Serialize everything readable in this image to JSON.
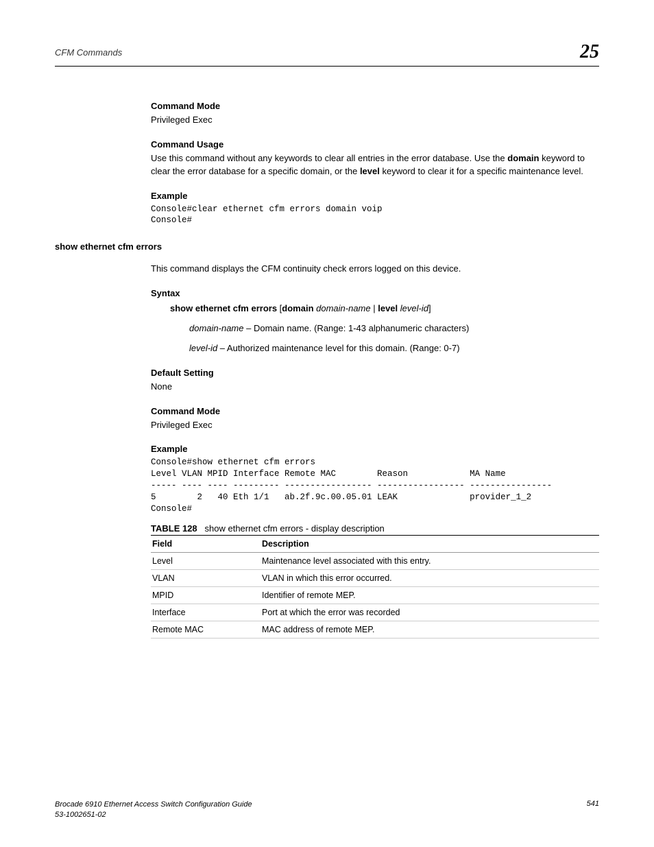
{
  "header": {
    "title": "CFM Commands",
    "chapter": "25"
  },
  "sections": {
    "commandMode1": {
      "heading": "Command Mode",
      "text": "Privileged Exec"
    },
    "commandUsage": {
      "heading": "Command Usage",
      "prefix": "Use this command without any keywords to clear all entries in the error database. Use the ",
      "kw1": "domain",
      "mid": " keyword to clear the error database for a specific domain, or the ",
      "kw2": "level",
      "suffix": " keyword to clear it for a specific maintenance level."
    },
    "example1": {
      "heading": "Example",
      "code": "Console#clear ethernet cfm errors domain voip\nConsole#"
    },
    "commandTitle": "show ethernet cfm errors",
    "intro": "This command displays the CFM continuity check errors logged on this device.",
    "syntax": {
      "heading": "Syntax",
      "cmd": "show ethernet cfm errors",
      "bracket_open": " [",
      "kw_domain": "domain",
      "domain_name": " domain-name",
      "pipe": " | ",
      "kw_level": "level",
      "level_id": " level-id",
      "bracket_close": "]",
      "domain_name_lbl": "domain-name",
      "domain_name_desc": " – Domain name. (Range: 1-43 alphanumeric characters)",
      "level_id_lbl": "level-id",
      "level_id_desc": " – Authorized maintenance level for this domain. (Range: 0-7)"
    },
    "defaultSetting": {
      "heading": "Default Setting",
      "text": "None"
    },
    "commandMode2": {
      "heading": "Command Mode",
      "text": "Privileged Exec"
    },
    "example2": {
      "heading": "Example",
      "code": "Console#show ethernet cfm errors\nLevel VLAN MPID Interface Remote MAC        Reason            MA Name\n----- ---- ---- --------- ----------------- ----------------- ----------------\n5        2   40 Eth 1/1   ab.2f.9c.00.05.01 LEAK              provider_1_2\nConsole#"
    },
    "table": {
      "label": "TABLE 128",
      "caption": "show ethernet cfm errors - display description",
      "headers": {
        "field": "Field",
        "description": "Description"
      },
      "rows": [
        {
          "field": "Level",
          "desc": "Maintenance level associated with this entry."
        },
        {
          "field": "VLAN",
          "desc": "VLAN in which this error occurred."
        },
        {
          "field": "MPID",
          "desc": "Identifier of remote MEP."
        },
        {
          "field": "Interface",
          "desc": "Port at which the error was recorded"
        },
        {
          "field": "Remote MAC",
          "desc": "MAC address of remote MEP."
        }
      ]
    }
  },
  "footer": {
    "title": "Brocade 6910 Ethernet Access Switch Configuration Guide",
    "docnum": "53-1002651-02",
    "page": "541"
  }
}
